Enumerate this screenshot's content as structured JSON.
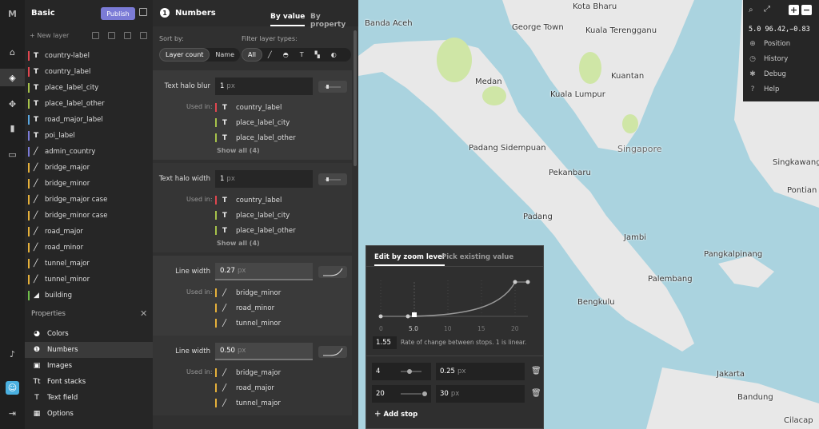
{
  "rail": {
    "logo": "M"
  },
  "style": {
    "name": "Basic",
    "publish_label": "Publish"
  },
  "layers_toolbar": {
    "new_layer": "+ New layer"
  },
  "layers": [
    {
      "name": "country-label",
      "type": "symbol",
      "color": "#e0464f"
    },
    {
      "name": "country_label",
      "type": "symbol",
      "color": "#e0464f"
    },
    {
      "name": "place_label_city",
      "type": "symbol",
      "color": "#a6c24a"
    },
    {
      "name": "place_label_other",
      "type": "symbol",
      "color": "#a6c24a"
    },
    {
      "name": "road_major_label",
      "type": "symbol",
      "color": "#5aa7e0"
    },
    {
      "name": "poi_label",
      "type": "symbol",
      "color": "#7b7bd6"
    },
    {
      "name": "admin_country",
      "type": "line",
      "color": "#7b7bd6"
    },
    {
      "name": "bridge_major",
      "type": "line",
      "color": "#e5b03a"
    },
    {
      "name": "bridge_minor",
      "type": "line",
      "color": "#e5b03a"
    },
    {
      "name": "bridge_major case",
      "type": "line",
      "color": "#e5b03a"
    },
    {
      "name": "bridge_minor case",
      "type": "line",
      "color": "#e5b03a"
    },
    {
      "name": "road_major",
      "type": "line",
      "color": "#e5b03a"
    },
    {
      "name": "road_minor",
      "type": "line",
      "color": "#e5b03a"
    },
    {
      "name": "tunnel_major",
      "type": "line",
      "color": "#e5b03a"
    },
    {
      "name": "tunnel_minor",
      "type": "line",
      "color": "#e5b03a"
    },
    {
      "name": "building",
      "type": "fill",
      "color": "#6fbf4a"
    }
  ],
  "properties": {
    "title": "Properties",
    "items": [
      {
        "label": "Colors",
        "icon": "palette-icon"
      },
      {
        "label": "Numbers",
        "icon": "numbers-icon",
        "selected": true
      },
      {
        "label": "Images",
        "icon": "image-icon"
      },
      {
        "label": "Font stacks",
        "icon": "font-icon"
      },
      {
        "label": "Text field",
        "icon": "text-field-icon"
      },
      {
        "label": "Options",
        "icon": "grid-icon"
      }
    ]
  },
  "numbers": {
    "title": "Numbers",
    "tabs": [
      "By value",
      "By property"
    ],
    "sort_label": "Sort by:",
    "sort_options": [
      "Layer count",
      "Name"
    ],
    "filter_label": "Filter layer types:",
    "filter_all": "All",
    "used_in_label": "Used in:",
    "sections": [
      {
        "name": "Text halo blur",
        "value": "1",
        "unit": "px",
        "used": [
          {
            "name": "country_label",
            "type": "symbol",
            "color": "#e0464f"
          },
          {
            "name": "place_label_city",
            "type": "symbol",
            "color": "#a6c24a"
          },
          {
            "name": "place_label_other",
            "type": "symbol",
            "color": "#a6c24a"
          }
        ],
        "show_all": "Show all (4)"
      },
      {
        "name": "Text halo width",
        "value": "1",
        "unit": "px",
        "used": [
          {
            "name": "country_label",
            "type": "symbol",
            "color": "#e0464f"
          },
          {
            "name": "place_label_city",
            "type": "symbol",
            "color": "#a6c24a"
          },
          {
            "name": "place_label_other",
            "type": "symbol",
            "color": "#a6c24a"
          }
        ],
        "show_all": "Show all (4)"
      },
      {
        "name": "Line width",
        "value": "0.27",
        "unit": "px",
        "used": [
          {
            "name": "bridge_minor",
            "type": "line",
            "color": "#e5b03a"
          },
          {
            "name": "road_minor",
            "type": "line",
            "color": "#e5b03a"
          },
          {
            "name": "tunnel_minor",
            "type": "line",
            "color": "#e5b03a"
          }
        ]
      },
      {
        "name": "Line width",
        "value": "0.50",
        "unit": "px",
        "used": [
          {
            "name": "bridge_major",
            "type": "line",
            "color": "#e5b03a"
          },
          {
            "name": "road_major",
            "type": "line",
            "color": "#e5b03a"
          },
          {
            "name": "tunnel_major",
            "type": "line",
            "color": "#e5b03a"
          }
        ]
      }
    ]
  },
  "zoom_popup": {
    "tabs": [
      "Edit by zoom level",
      "Pick existing value"
    ],
    "axis_ticks": [
      "0",
      "5.0",
      "10",
      "15",
      "20"
    ],
    "rate": "1.55",
    "rate_text": "Rate of change between stops. 1 is linear.",
    "stops": [
      {
        "zoom": "4",
        "value": "0.25",
        "unit": "px"
      },
      {
        "zoom": "20",
        "value": "30",
        "unit": "px"
      }
    ],
    "add_stop": "Add stop"
  },
  "map_controls": {
    "coords": "5.0 96.42,−0.83",
    "items": [
      "Position",
      "History",
      "Debug",
      "Help"
    ]
  },
  "map_labels": [
    "Kota Bharu",
    "Banda Aceh",
    "George Town",
    "Kuala Terengganu",
    "Medan",
    "Kuantan",
    "Kuala Lumpur",
    "Padang Sidempuan",
    "Singapore",
    "Pekanbaru",
    "Singkawang",
    "Pontian",
    "Padang",
    "Jambi",
    "Pangkalpinang",
    "Palembang",
    "Bengkulu",
    "Jakarta",
    "Bandung",
    "Cilacap"
  ],
  "colors": {
    "water": "#aad3df",
    "land": "#e8e8e8",
    "park": "#cfe6a6",
    "accent": "#7b7bd6"
  }
}
